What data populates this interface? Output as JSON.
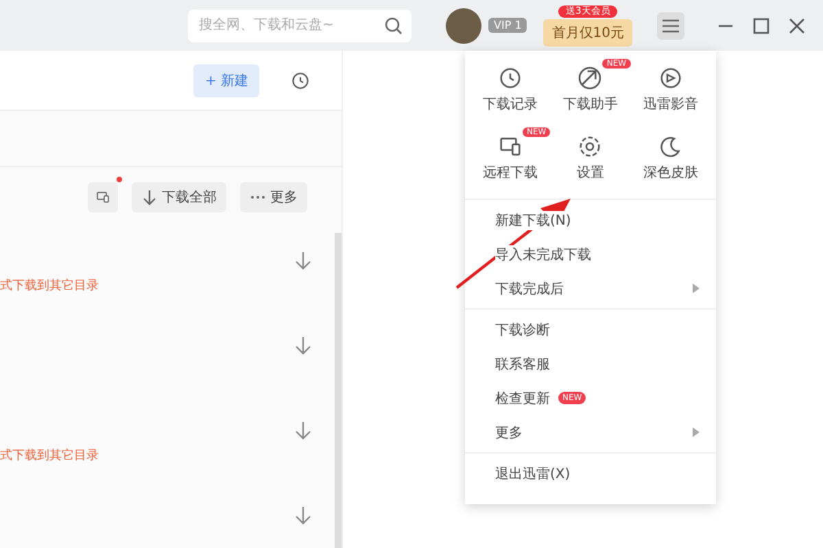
{
  "titlebar": {
    "search": {
      "placeholder": "搜全网、下载和云盘~"
    },
    "vip_badge": "VIP 1",
    "promo": {
      "label": "首月仅10元",
      "badge": "送3天会员"
    }
  },
  "left_panel": {
    "new_button": "+ 新建",
    "toolbar": {
      "download_all": "下载全部",
      "more": "更多"
    },
    "rows": [
      {
        "note": "式下载到其它目录"
      },
      {},
      {
        "note": "式下载到其它目录"
      },
      {}
    ]
  },
  "menu": {
    "grid": [
      {
        "label": "下载记录"
      },
      {
        "label": "下载助手",
        "badge": "NEW"
      },
      {
        "label": "迅雷影音"
      },
      {
        "label": "远程下载",
        "badge": "NEW"
      },
      {
        "label": "设置"
      },
      {
        "label": "深色皮肤"
      }
    ],
    "sections": [
      [
        {
          "label": "新建下载(N)",
          "submenu": false
        },
        {
          "label": "导入未完成下载",
          "submenu": false
        },
        {
          "label": "下载完成后",
          "submenu": true
        }
      ],
      [
        {
          "label": "下载诊断",
          "submenu": false
        },
        {
          "label": "联系客服",
          "submenu": false
        },
        {
          "label": "检查更新",
          "submenu": false,
          "badge": "NEW"
        },
        {
          "label": "更多",
          "submenu": true
        }
      ],
      [
        {
          "label": "退出迅雷(X)",
          "submenu": false
        }
      ]
    ]
  }
}
